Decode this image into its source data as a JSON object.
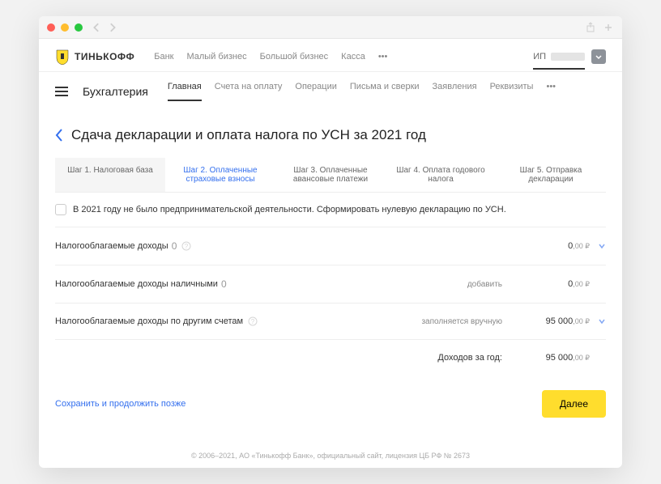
{
  "logo_text": "ТИНЬКОФФ",
  "topnav": {
    "links": [
      "Банк",
      "Малый бизнес",
      "Большой бизнес",
      "Касса"
    ],
    "account_prefix": "ИП"
  },
  "subnav": {
    "title": "Бухгалтерия",
    "tabs": [
      "Главная",
      "Счета на оплату",
      "Операции",
      "Письма и сверки",
      "Заявления",
      "Реквизиты"
    ],
    "active_index": 0
  },
  "page_title": "Сдача декларации и оплата налога по УСН за 2021 год",
  "steps": [
    "Шаг 1. Налоговая база",
    "Шаг 2. Оплаченные страховые взносы",
    "Шаг 3. Оплаченные авансовые платежи",
    "Шаг 4. Оплата годового налога",
    "Шаг 5. Отправка декларации"
  ],
  "checkbox_text": "В 2021 году не было предпринимательской деятельности. Сформировать нулевую декларацию по УСН.",
  "rows": [
    {
      "label": "Налогооблагаемые доходы",
      "count": "0",
      "action": "",
      "amount_int": "0",
      "amount_dec": ",00 ₽",
      "has_help": true,
      "expandable": true
    },
    {
      "label": "Налогооблагаемые доходы наличными",
      "count": "0",
      "action": "добавить",
      "amount_int": "0",
      "amount_dec": ",00 ₽",
      "has_help": false,
      "expandable": false
    },
    {
      "label": "Налогооблагаемые доходы по другим счетам",
      "count": "",
      "action": "заполняется вручную",
      "amount_int": "95 000",
      "amount_dec": ",00 ₽",
      "has_help": true,
      "expandable": true
    }
  ],
  "total_label": "Доходов за год:",
  "total_int": "95 000",
  "total_dec": ",00 ₽",
  "save_link": "Сохранить и продолжить позже",
  "next_button": "Далее",
  "footer": "© 2006–2021, АО «Тинькофф Банк», официальный сайт, лицензия ЦБ РФ № 2673"
}
